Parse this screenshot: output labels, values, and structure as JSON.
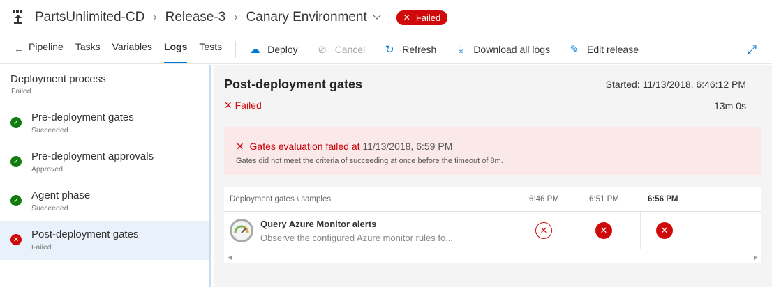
{
  "header": {
    "breadcrumbs": [
      "PartsUnlimited-CD",
      "Release-3",
      "Canary Environment"
    ],
    "status_badge": "Failed"
  },
  "toolbar": {
    "tabs": [
      "Pipeline",
      "Tasks",
      "Variables",
      "Logs",
      "Tests"
    ],
    "active_tab": "Logs",
    "actions": {
      "deploy": "Deploy",
      "cancel": "Cancel",
      "refresh": "Refresh",
      "download_logs": "Download all logs",
      "edit_release": "Edit release"
    }
  },
  "left_panel": {
    "title": "Deployment process",
    "status": "Failed",
    "steps": [
      {
        "label": "Pre-deployment gates",
        "status": "Succeeded",
        "state": "success"
      },
      {
        "label": "Pre-deployment approvals",
        "status": "Approved",
        "state": "success"
      },
      {
        "label": "Agent phase",
        "status": "Succeeded",
        "state": "success"
      },
      {
        "label": "Post-deployment gates",
        "status": "Failed",
        "state": "failed"
      }
    ],
    "selected_index": 3
  },
  "main": {
    "title": "Post-deployment gates",
    "status": "Failed",
    "started": "Started: 11/13/2018, 6:46:12 PM",
    "duration": "13m 0s",
    "alert": {
      "title_prefix": "Gates evaluation failed at",
      "title_date": "11/13/2018, 6:59 PM",
      "description": "Gates did not meet the criteria of succeeding at once before the timeout of 8m."
    },
    "grid": {
      "header_label": "Deployment gates \\ samples",
      "samples": [
        "6:46 PM",
        "6:51 PM",
        "6:56 PM"
      ],
      "rows": [
        {
          "title": "Query Azure Monitor alerts",
          "description": "Observe the configured Azure monitor rules fo...",
          "results": [
            "failed-outline",
            "failed",
            "failed"
          ]
        }
      ]
    }
  },
  "colors": {
    "accent": "#0078d4",
    "failed": "#d00a0a",
    "success": "#107c10"
  }
}
